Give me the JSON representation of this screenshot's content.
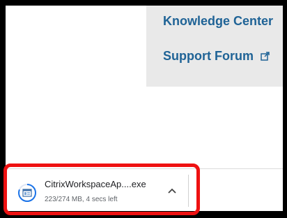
{
  "menu": {
    "items": [
      {
        "label": "Knowledge Center",
        "external": false
      },
      {
        "label": "Support Forum",
        "external": true
      }
    ]
  },
  "download": {
    "file_name": "CitrixWorkspaceAp....exe",
    "status": "223/274 MB, 4 secs left",
    "progress_fraction": 0.81,
    "icon": "installer-file-icon",
    "toggle_icon": "chevron-up-icon"
  },
  "colors": {
    "link": "#1f6396",
    "menu_background": "#e9e9e9",
    "annotation_highlight": "#ee1111",
    "frame": "#000000"
  }
}
